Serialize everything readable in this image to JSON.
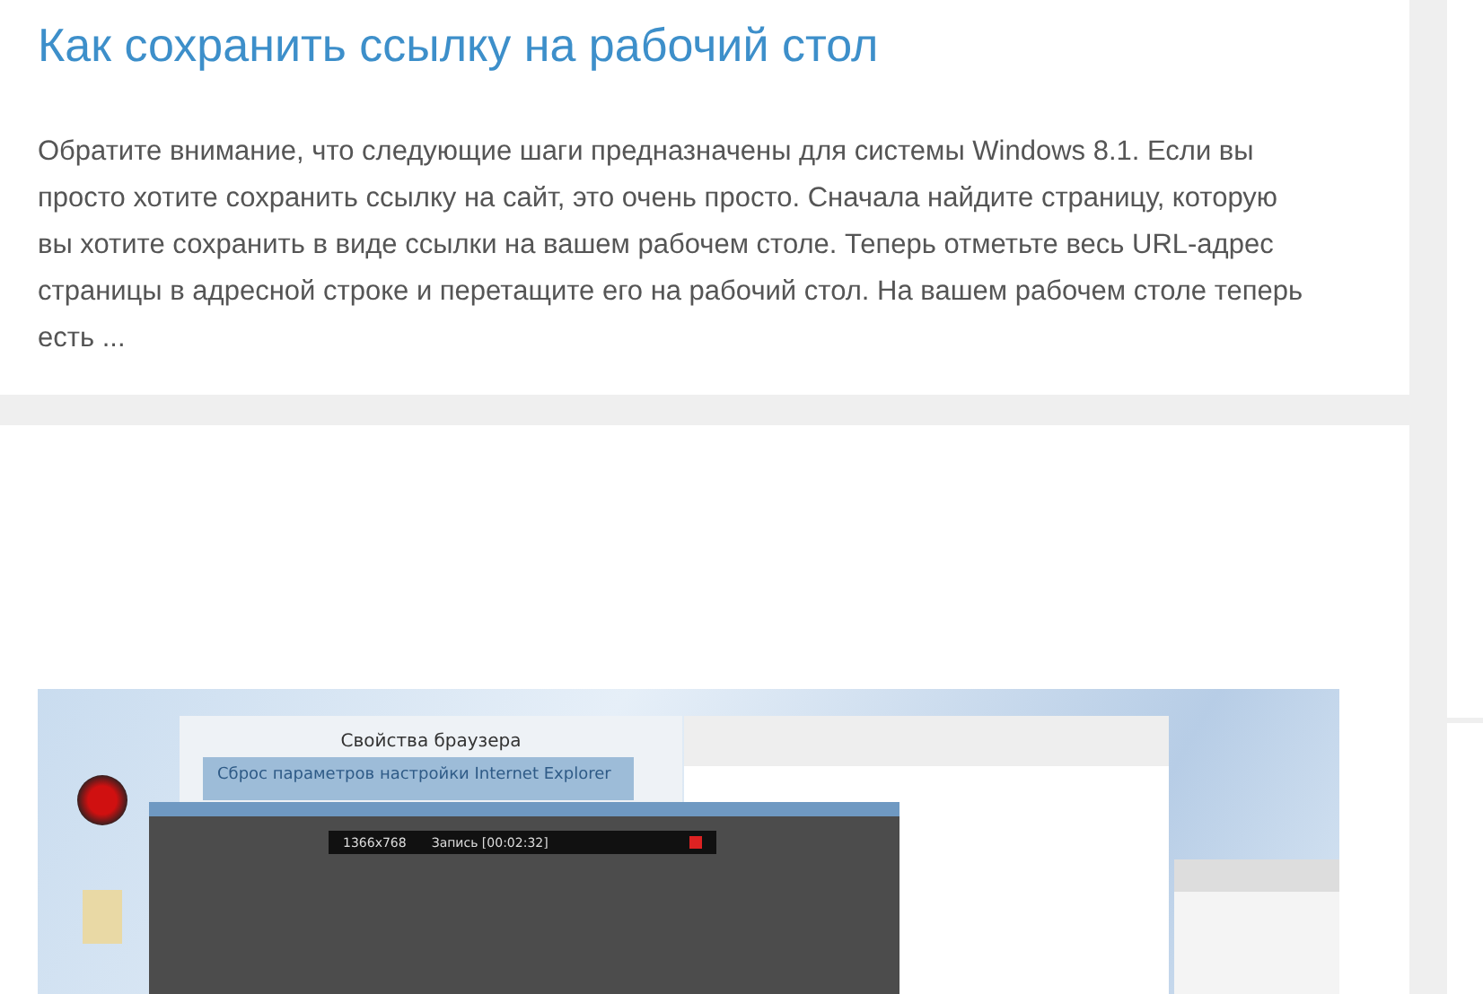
{
  "article": {
    "title": "Как сохранить ссылку на рабочий стол",
    "excerpt": "Обратите внимание, что следующие шаги предназначены для системы Windows 8.1. Если вы просто хотите сохранить ссылку на сайт, это очень просто. Сначала найдите страницу, которую вы хотите сохранить в виде ссылки на вашем рабочем столе. Теперь отметьте весь URL-адрес страницы в адресной строке и перетащите его на рабочий стол. На вашем рабочем столе теперь есть ..."
  },
  "screenshot": {
    "dialog_title": "Свойства браузера",
    "dialog_header": "Сброс параметров настройки Internet Explorer",
    "recorder_resolution": "1366x768",
    "recorder_status": "Запись [00:02:32]"
  }
}
